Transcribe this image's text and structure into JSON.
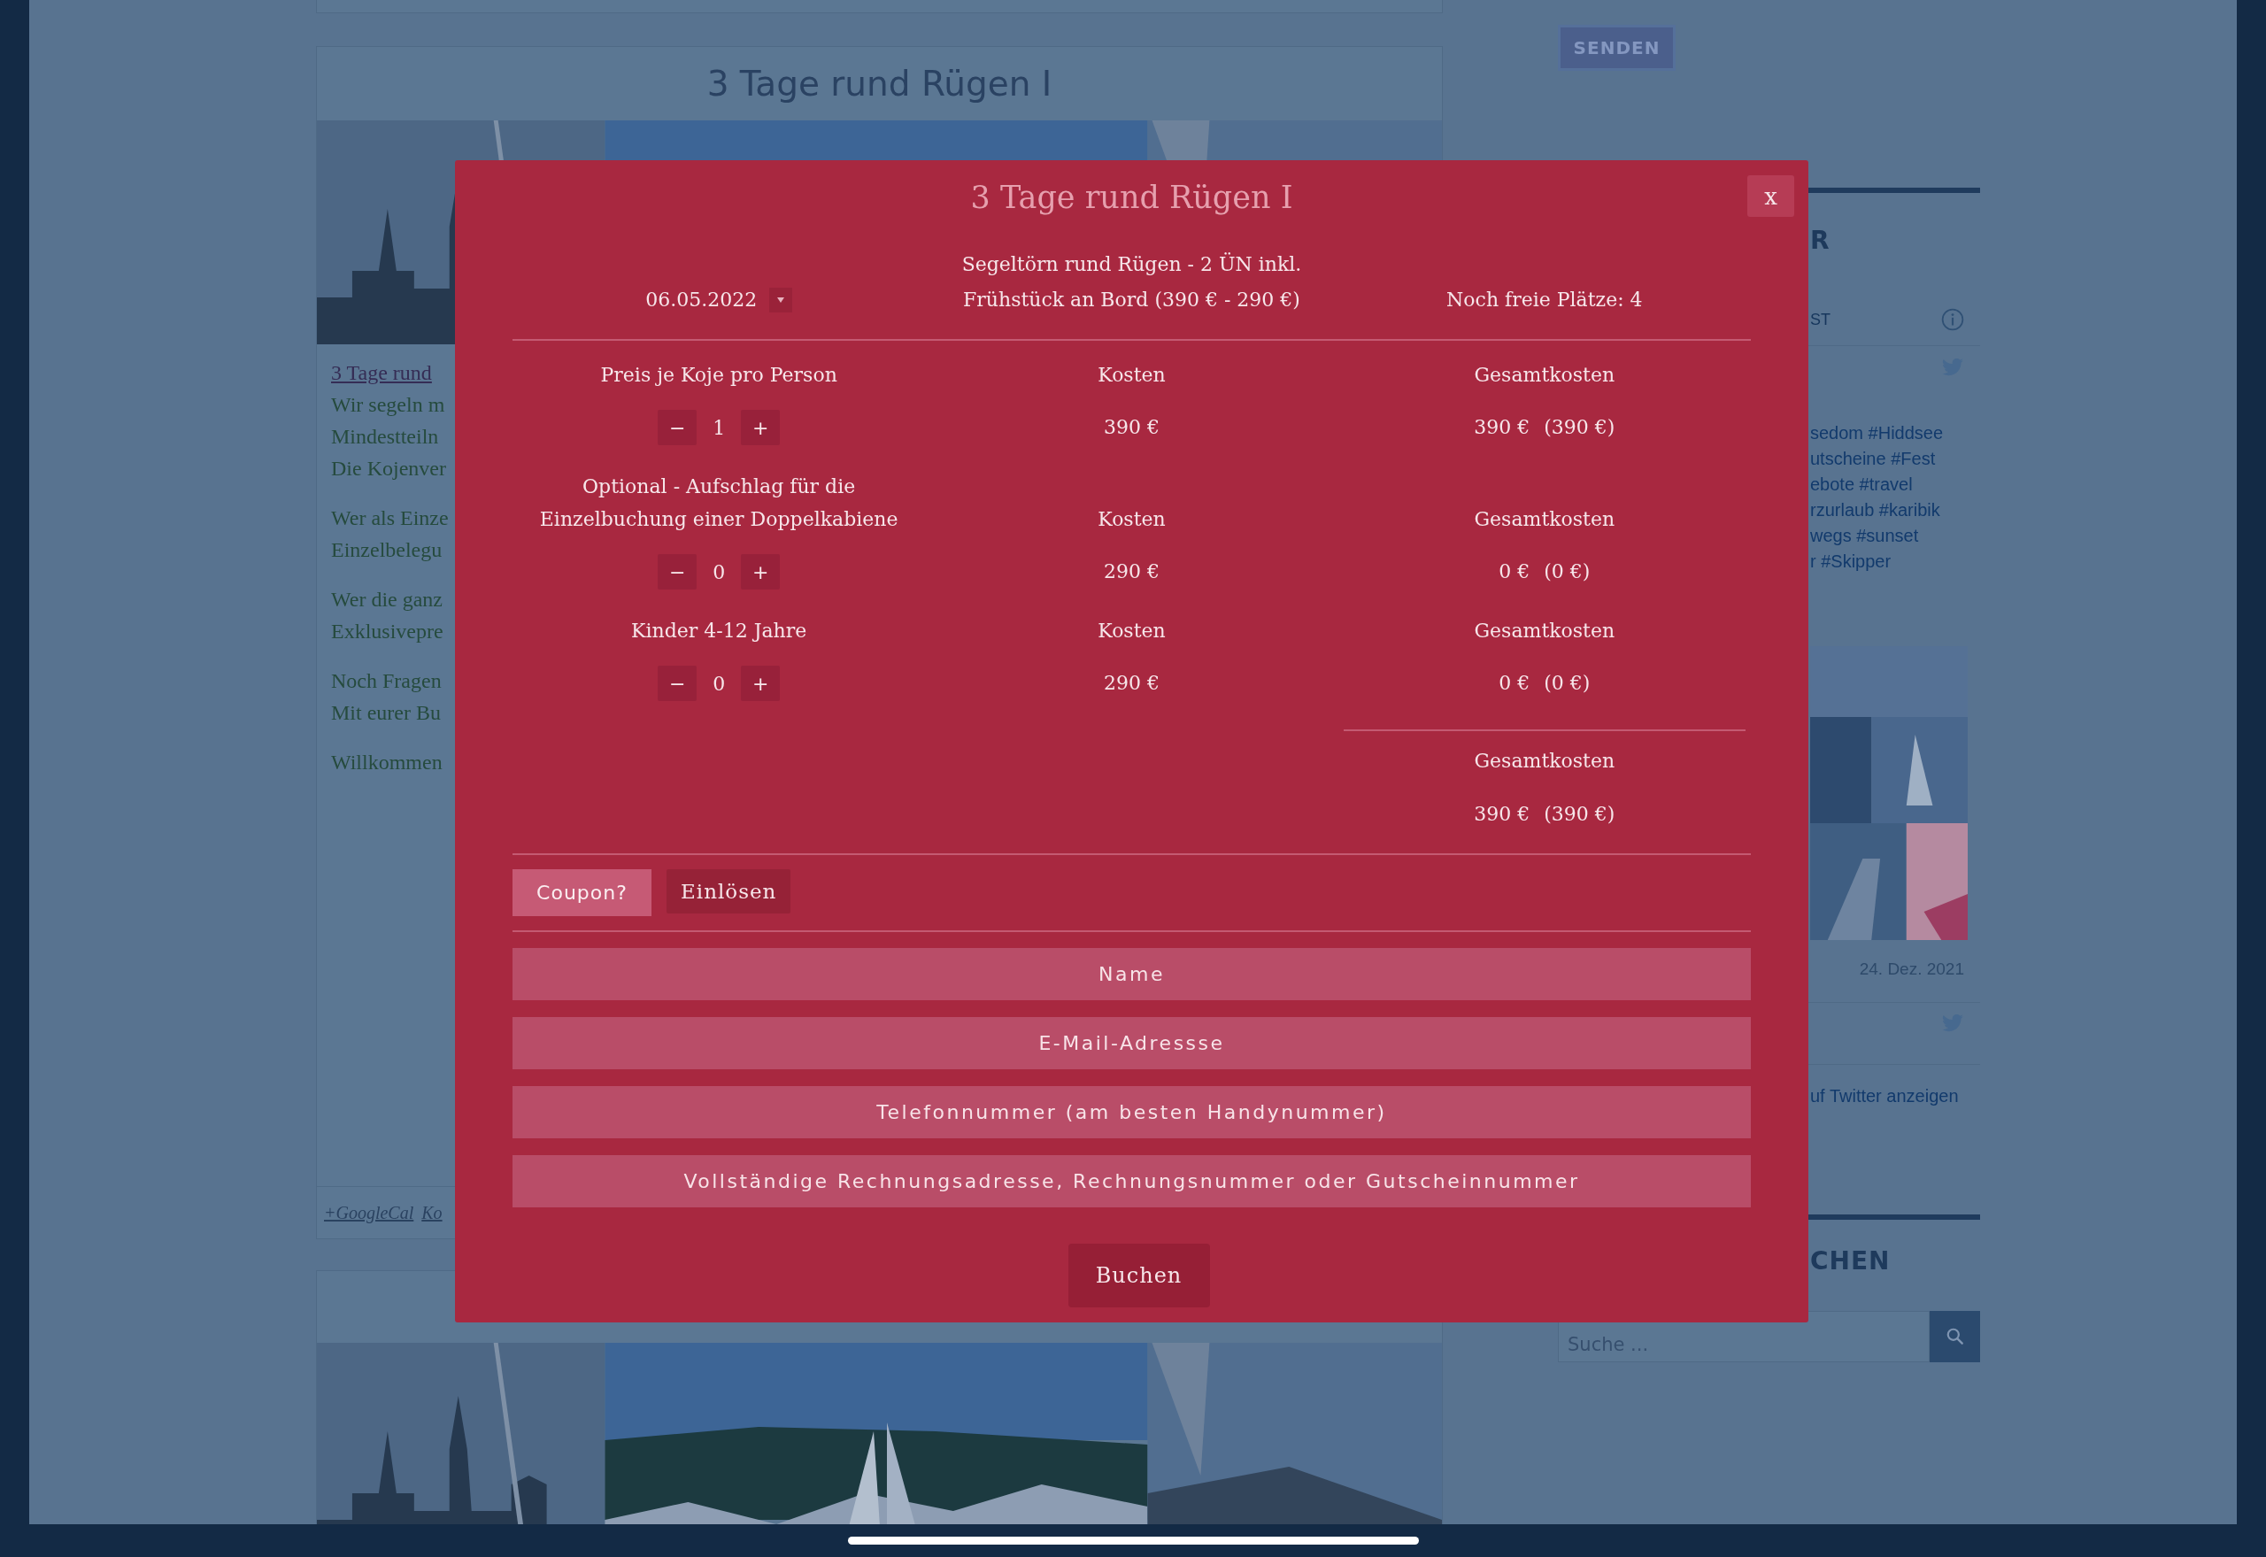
{
  "page": {
    "article_card": {
      "title": "3 Tage rund Rügen I",
      "link": "3 Tage rund",
      "paragraphs": [
        [
          "Wir segeln m",
          "Mindestteiln",
          "Die Kojenver"
        ],
        [
          "Wer als Einze",
          "Einzelbelegu"
        ],
        [
          "Wer die ganz",
          "Exklusivepre"
        ],
        [
          "Noch Fragen",
          "Mit eurer Bu"
        ],
        [
          "Willkommen"
        ]
      ],
      "footer_links": [
        "+GoogleCal",
        "Ko"
      ]
    },
    "sidebar": {
      "send_button": "SENDEN",
      "heading_1": "R",
      "feed_label": "ST",
      "hashtags": [
        "sedom #Hiddsee",
        "utscheine #Fest",
        "ebote #travel",
        "rzurlaub #karibik",
        "wegs #sunset",
        "r #Skipper"
      ],
      "date": "24. Dez. 2021",
      "twitter_link": "uf Twitter anzeigen",
      "heading_2": "CHEN",
      "search": {
        "placeholder": "Suche ..."
      }
    }
  },
  "modal": {
    "title": "3 Tage rund Rügen I",
    "close": "x",
    "date": "06.05.2022",
    "description": [
      "Segeltörn rund Rügen - 2 ÜN inkl.",
      "Frühstück an Bord (390 € - 290 €)"
    ],
    "free_places": "Noch freie Plätze: 4",
    "items": [
      {
        "label": "Preis je Koje pro Person",
        "cost_label": "Kosten",
        "total_label": "Gesamtkosten",
        "decrement": "−",
        "quantity": "1",
        "increment": "+",
        "cost": "390 €",
        "total": "390 €",
        "total_gross": "(390 €)"
      },
      {
        "label": "Optional - Aufschlag für die Einzelbuchung einer Doppelkabiene",
        "cost_label": "Kosten",
        "total_label": "Gesamtkosten",
        "decrement": "−",
        "quantity": "0",
        "increment": "+",
        "cost": "290 €",
        "total": "0 €",
        "total_gross": "(0 €)"
      },
      {
        "label": "Kinder 4-12 Jahre",
        "cost_label": "Kosten",
        "total_label": "Gesamtkosten",
        "decrement": "−",
        "quantity": "0",
        "increment": "+",
        "cost": "290 €",
        "total": "0 €",
        "total_gross": "(0 €)"
      }
    ],
    "summary": {
      "label": "Gesamtkosten",
      "total": "390 €",
      "total_gross": "(390 €)"
    },
    "coupon": {
      "placeholder": "Coupon?",
      "button": "Einlösen"
    },
    "fields": [
      {
        "placeholder": "Name"
      },
      {
        "placeholder": "E-Mail-Adressse"
      },
      {
        "placeholder": "Telefonnummer (am besten Handynummer)"
      },
      {
        "placeholder": "Vollständige Rechnungsadresse, Rechnungsnummer oder Gutscheinnummer"
      }
    ],
    "submit": "Buchen"
  }
}
